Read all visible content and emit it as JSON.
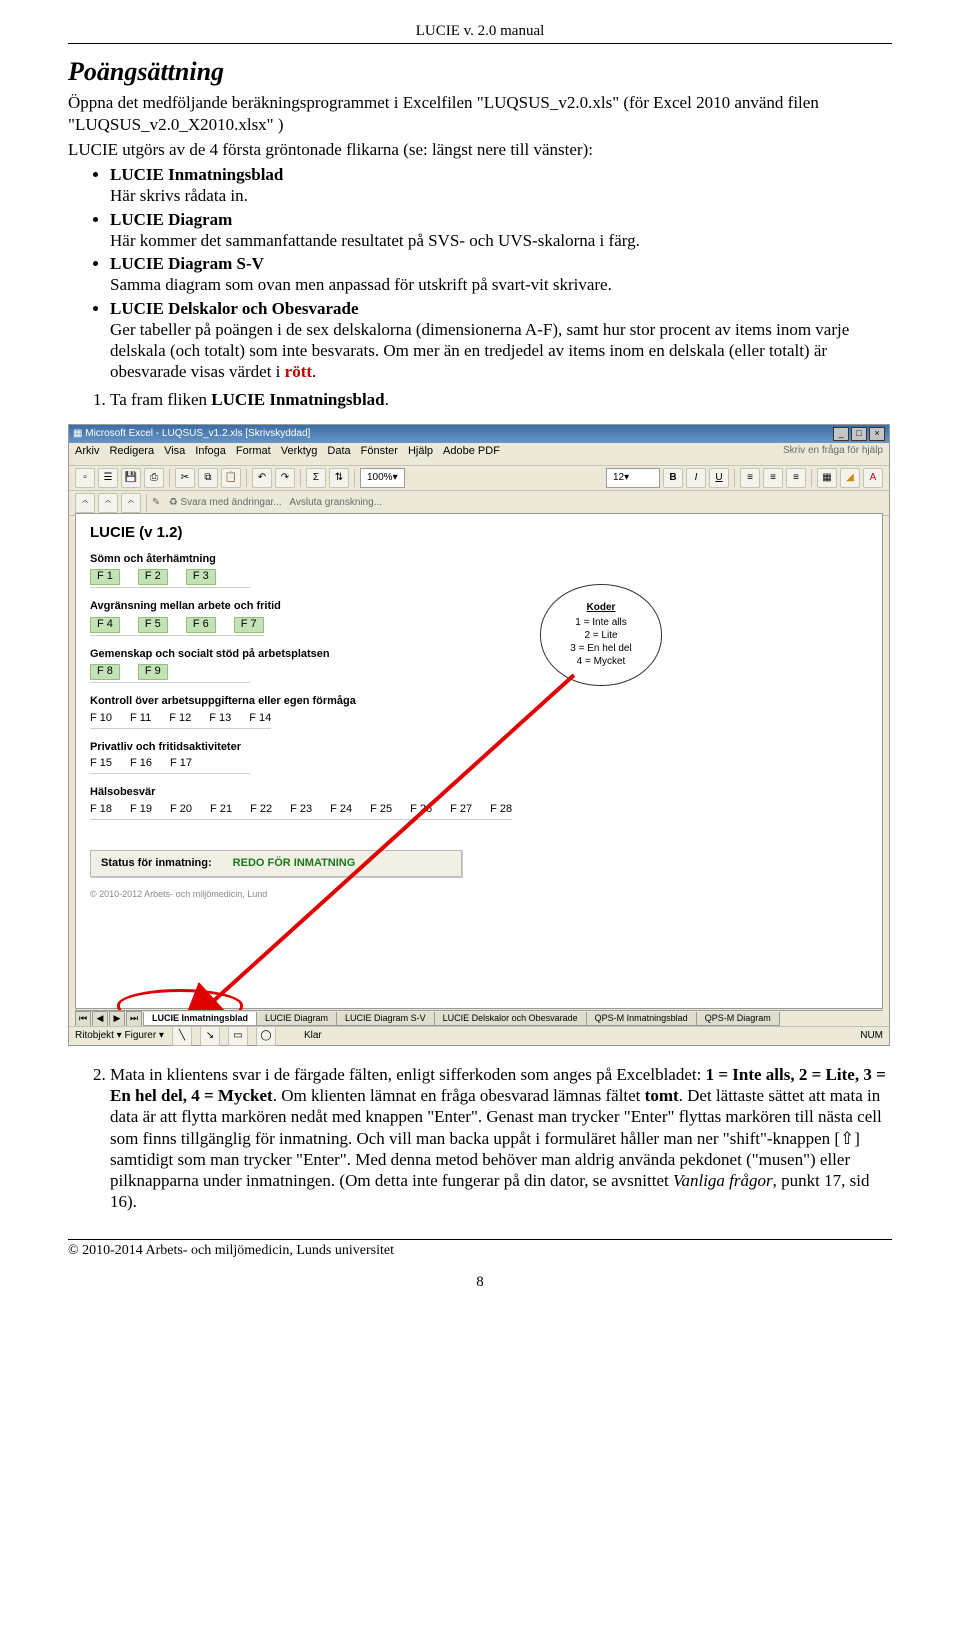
{
  "header": {
    "title": "LUCIE v. 2.0 manual"
  },
  "section": {
    "title": "Poängsättning",
    "intro": "Öppna det medföljande beräkningsprogrammet i Excelfilen \"LUQSUS_v2.0.xls\" (för Excel 2010 använd filen \"LUQSUS_v2.0_X2010.xlsx\" )",
    "intro2": "LUCIE utgörs av de 4 första gröntonade flikarna (se: längst nere till vänster):",
    "bullets": [
      {
        "b": "LUCIE Inmatningsblad",
        "t": "Här skrivs rådata in."
      },
      {
        "b": "LUCIE Diagram",
        "t": "Här kommer det sammanfattande resultatet på SVS- och UVS-skalorna i färg."
      },
      {
        "b": "LUCIE Diagram S-V",
        "t": "Samma diagram som ovan men anpassad för utskrift på svart-vit skrivare."
      },
      {
        "b": "LUCIE Delskalor och Obesvarade",
        "t_pre": "Ger tabeller på poängen i de sex delskalorna (dimensionerna A-F), samt hur stor procent av items inom varje delskala (och totalt) som inte besvarats. Om mer än en tredjedel av items inom en delskala (eller totalt) är obesvarade visas värdet i ",
        "t_red": "rött",
        "t_post": "."
      }
    ],
    "step1": "Ta fram fliken ",
    "step1_bold": "LUCIE Inmatningsblad",
    "step1_end": ".",
    "step2_pre": "Mata in klientens svar i de färgade fälten, enligt sifferkoden som anges på Excelbladet: ",
    "step2_bold": "1 = Inte alls, 2 = Lite, 3 = En hel del, 4 = Mycket",
    "step2_post": ". Om klienten lämnat en fråga obesvarad lämnas fältet ",
    "step2_bold2": "tomt",
    "step2_post2": ". Det lättaste sättet att mata in data är att flytta markören nedåt med knappen \"Enter\". Genast man trycker \"Enter\" flyttas markören till nästa cell som finns tillgänglig för inmatning. Och vill man backa uppåt i formuläret håller man ner \"shift\"-knappen [⇧] samtidigt som man trycker \"Enter\". Med denna metod behöver man aldrig använda pekdonet (\"musen\") eller pilknapparna under inmatningen. (Om detta inte fungerar på din dator, se avsnittet ",
    "step2_ital": "Vanliga frågor",
    "step2_post3": ", punkt 17, sid 16)."
  },
  "screenshot": {
    "titlebar": "Microsoft Excel - LUQSUS_v1.2.xls [Skrivskyddad]",
    "menus": [
      "Arkiv",
      "Redigera",
      "Visa",
      "Infoga",
      "Format",
      "Verktyg",
      "Data",
      "Fönster",
      "Hjälp",
      "Adobe PDF"
    ],
    "helphint": "Skriv en fråga för hjälp",
    "zoom": "100%",
    "fontsize": "12",
    "apptitle": "LUCIE (v 1.2)",
    "groups": [
      {
        "title": "Sömn och återhämtning",
        "fields": [
          "F 1",
          "F 2",
          "F 3"
        ],
        "green": true
      },
      {
        "title": "Avgränsning mellan arbete och fritid",
        "fields": [
          "F 4",
          "F 5",
          "F 6",
          "F 7"
        ],
        "green": true
      },
      {
        "title": "Gemenskap och socialt stöd på arbetsplatsen",
        "fields": [
          "F 8",
          "F 9"
        ],
        "green": true
      },
      {
        "title": "Kontroll över arbetsuppgifterna eller egen förmåga",
        "fields": [
          "F 10",
          "F 11",
          "F 12",
          "F 13",
          "F 14"
        ],
        "green": false
      },
      {
        "title": "Privatliv och fritidsaktiviteter",
        "fields": [
          "F 15",
          "F 16",
          "F 17"
        ],
        "green": false
      },
      {
        "title": "Hälsobesvär",
        "fields": [
          "F 18",
          "F 19",
          "F 20",
          "F 21",
          "F 22",
          "F 23",
          "F 24",
          "F 25",
          "F 26",
          "F 27",
          "F 28"
        ],
        "green": false
      }
    ],
    "koder": {
      "title": "Koder",
      "lines": [
        "1 = Inte alls",
        "2 = Lite",
        "3 = En hel del",
        "4 = Mycket"
      ]
    },
    "status_label": "Status för inmatning:",
    "status_value": "REDO FÖR INMATNING",
    "copyright": "© 2010-2012 Arbets- och miljömedicin, Lund",
    "tabs": [
      "LUCIE Inmatningsblad",
      "LUCIE Diagram",
      "LUCIE Diagram S-V",
      "LUCIE Delskalor och Obesvarade",
      "QPS-M Inmatningsblad",
      "QPS-M Diagram"
    ],
    "drawbar_left": "Ritobjekt ▾   Figurer ▾",
    "drawbar_klar": "Klar",
    "drawbar_num": "NUM"
  },
  "footer": {
    "copyright": "© 2010-2014 Arbets- och miljömedicin, Lunds universitet",
    "page": "8"
  }
}
